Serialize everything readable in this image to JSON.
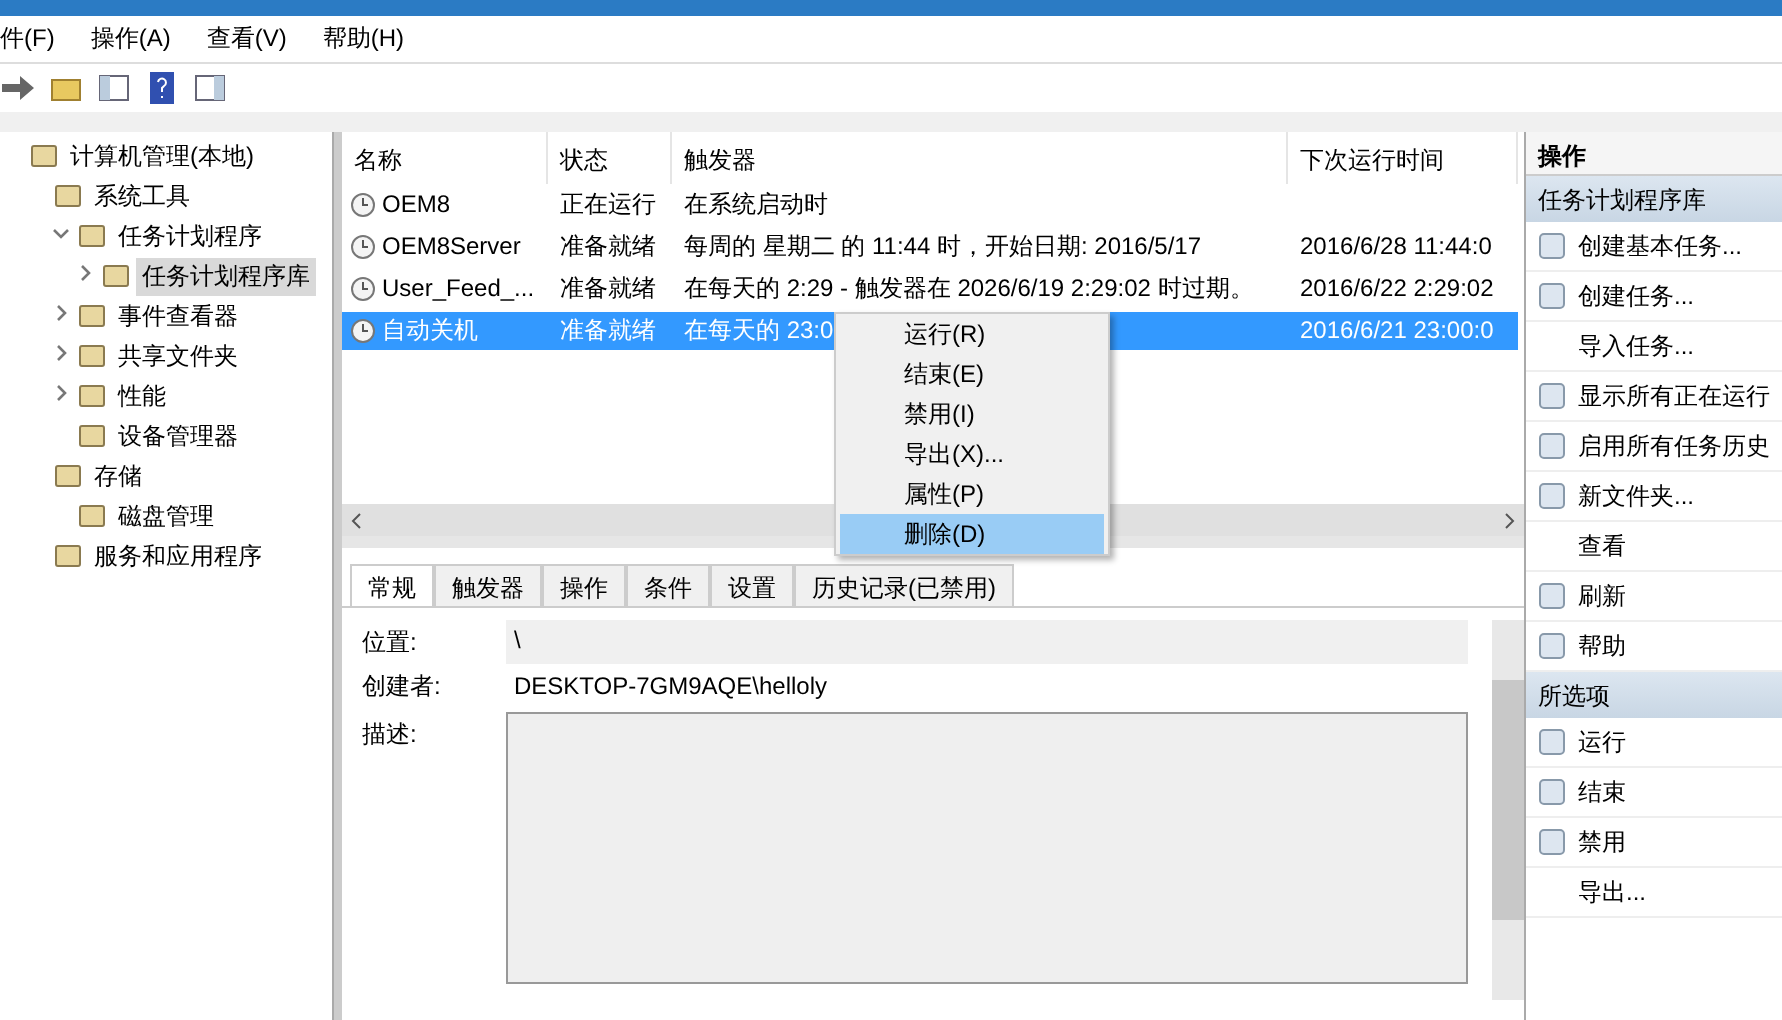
{
  "menu_bar": [
    "件(F)",
    "操作(A)",
    "查看(V)",
    "帮助(H)"
  ],
  "tree": [
    {
      "label": "计算机管理(本地)",
      "selected": false,
      "children": [
        {
          "label": "系统工具",
          "selected": false,
          "children": [
            {
              "label": "任务计划程序",
              "selected": false,
              "expanded": true,
              "children": [
                {
                  "label": "任务计划程序库",
                  "selected": true,
                  "expanded": false
                }
              ]
            },
            {
              "label": "事件查看器",
              "selected": false,
              "expanded": false
            },
            {
              "label": "共享文件夹",
              "selected": false,
              "expanded": false
            },
            {
              "label": "性能",
              "selected": false,
              "expanded": false
            },
            {
              "label": "设备管理器",
              "selected": false
            }
          ]
        },
        {
          "label": "存储",
          "selected": false,
          "children": [
            {
              "label": "磁盘管理",
              "selected": false
            }
          ]
        },
        {
          "label": "服务和应用程序",
          "selected": false
        }
      ]
    }
  ],
  "table": {
    "columns": [
      "名称",
      "状态",
      "触发器",
      "下次运行时间"
    ],
    "rows": [
      {
        "name": "OEM8",
        "status": "正在运行",
        "trigger": "在系统启动时",
        "selected": false
      },
      {
        "name": "OEM8Server",
        "status": "准备就绪",
        "trigger": "每周的 星期二 的 11:44 时，开始日期: 2016/5/17",
        "next_run": "2016/6/28 11:44:0",
        "selected": false
      },
      {
        "name": "User_Feed_...",
        "status": "准备就绪",
        "trigger": "在每天的 2:29 - 触发器在 2026/6/19 2:29:02 时过期。",
        "next_run": "2016/6/22 2:29:02",
        "selected": false
      },
      {
        "name": "自动关机",
        "status": "准备就绪",
        "trigger": "在每天的 23:0",
        "next_run": "2016/6/21 23:00:0",
        "selected": true
      }
    ]
  },
  "context_menu": [
    {
      "label": "运行(R)",
      "selected": false
    },
    {
      "label": "结束(E)",
      "selected": false
    },
    {
      "label": "禁用(I)",
      "selected": false
    },
    {
      "label": "导出(X)...",
      "selected": false
    },
    {
      "label": "属性(P)",
      "selected": false
    },
    {
      "label": "删除(D)",
      "selected": true
    }
  ],
  "detail_tabs": [
    {
      "label": "常规",
      "selected": true
    },
    {
      "label": "触发器",
      "selected": false
    },
    {
      "label": "操作",
      "selected": false
    },
    {
      "label": "条件",
      "selected": false
    },
    {
      "label": "设置",
      "selected": false
    },
    {
      "label": "历史记录(已禁用)",
      "selected": false
    }
  ],
  "details": {
    "location_label": "位置:",
    "location": "\\",
    "author_label": "创建者:",
    "author": "DESKTOP-7GM9AQE\\helloly",
    "description_label": "描述:"
  },
  "actions": {
    "title": "操作",
    "sections": [
      {
        "title": "任务计划程序库",
        "items": [
          {
            "label": "创建基本任务...",
            "has_icon": true
          },
          {
            "label": "创建任务...",
            "has_icon": true
          },
          {
            "label": "导入任务...",
            "has_icon": false
          },
          {
            "label": "显示所有正在运行",
            "has_icon": true
          },
          {
            "label": "启用所有任务历史",
            "has_icon": true
          },
          {
            "label": "新文件夹...",
            "has_icon": true
          },
          {
            "label": "查看",
            "has_icon": false
          },
          {
            "label": "刷新",
            "has_icon": true
          },
          {
            "label": "帮助",
            "has_icon": true
          }
        ]
      },
      {
        "title": "所选项",
        "items": [
          {
            "label": "运行",
            "has_icon": true
          },
          {
            "label": "结束",
            "has_icon": true
          },
          {
            "label": "禁用",
            "has_icon": true
          },
          {
            "label": "导出...",
            "has_icon": false
          }
        ]
      }
    ]
  }
}
